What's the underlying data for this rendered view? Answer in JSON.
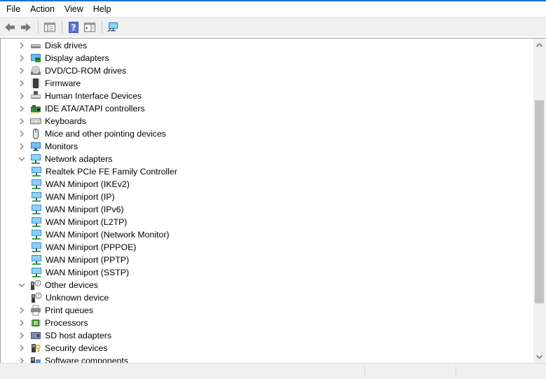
{
  "menu": [
    {
      "key": "file",
      "label": "File"
    },
    {
      "key": "action",
      "label": "Action"
    },
    {
      "key": "view",
      "label": "View"
    },
    {
      "key": "help",
      "label": "Help"
    }
  ],
  "toolbar": [
    {
      "name": "back-button",
      "icon": "arrow-left-icon"
    },
    {
      "name": "forward-button",
      "icon": "arrow-right-icon"
    },
    {
      "sep": true
    },
    {
      "name": "show-hide-console-tree-button",
      "icon": "console-tree-icon"
    },
    {
      "sep": true
    },
    {
      "name": "help-button",
      "icon": "help-icon"
    },
    {
      "name": "show-action-pane-button",
      "icon": "action-pane-icon"
    },
    {
      "sep": true
    },
    {
      "name": "scan-hardware-changes-button",
      "icon": "monitor-scan-icon"
    }
  ],
  "tree": [
    {
      "label": "Disk drives",
      "level": 0,
      "state": "collapsed",
      "icon": "disk-drive"
    },
    {
      "label": "Display adapters",
      "level": 0,
      "state": "collapsed",
      "icon": "display-adapter"
    },
    {
      "label": "DVD/CD-ROM drives",
      "level": 0,
      "state": "collapsed",
      "icon": "dvd"
    },
    {
      "label": "Firmware",
      "level": 0,
      "state": "collapsed",
      "icon": "firmware"
    },
    {
      "label": "Human Interface Devices",
      "level": 0,
      "state": "collapsed",
      "icon": "hid"
    },
    {
      "label": "IDE ATA/ATAPI controllers",
      "level": 0,
      "state": "collapsed",
      "icon": "ide-controller"
    },
    {
      "label": "Keyboards",
      "level": 0,
      "state": "collapsed",
      "icon": "keyboard"
    },
    {
      "label": "Mice and other pointing devices",
      "level": 0,
      "state": "collapsed",
      "icon": "mouse"
    },
    {
      "label": "Monitors",
      "level": 0,
      "state": "collapsed",
      "icon": "monitor"
    },
    {
      "label": "Network adapters",
      "level": 0,
      "state": "expanded",
      "icon": "network"
    },
    {
      "label": "Realtek PCIe FE Family Controller",
      "level": 1,
      "state": "none",
      "icon": "network"
    },
    {
      "label": "WAN Miniport (IKEv2)",
      "level": 1,
      "state": "none",
      "icon": "network"
    },
    {
      "label": "WAN Miniport (IP)",
      "level": 1,
      "state": "none",
      "icon": "network"
    },
    {
      "label": "WAN Miniport (IPv6)",
      "level": 1,
      "state": "none",
      "icon": "network"
    },
    {
      "label": "WAN Miniport (L2TP)",
      "level": 1,
      "state": "none",
      "icon": "network"
    },
    {
      "label": "WAN Miniport (Network Monitor)",
      "level": 1,
      "state": "none",
      "icon": "network"
    },
    {
      "label": "WAN Miniport (PPPOE)",
      "level": 1,
      "state": "none",
      "icon": "network"
    },
    {
      "label": "WAN Miniport (PPTP)",
      "level": 1,
      "state": "none",
      "icon": "network"
    },
    {
      "label": "WAN Miniport (SSTP)",
      "level": 1,
      "state": "none",
      "icon": "network"
    },
    {
      "label": "Other devices",
      "level": 0,
      "state": "expanded",
      "icon": "unknown-device"
    },
    {
      "label": "Unknown device",
      "level": 1,
      "state": "none",
      "icon": "unknown-device"
    },
    {
      "label": "Print queues",
      "level": 0,
      "state": "collapsed",
      "icon": "printer"
    },
    {
      "label": "Processors",
      "level": 0,
      "state": "collapsed",
      "icon": "processor"
    },
    {
      "label": "SD host adapters",
      "level": 0,
      "state": "collapsed",
      "icon": "sd-adapter"
    },
    {
      "label": "Security devices",
      "level": 0,
      "state": "collapsed",
      "icon": "security-device"
    },
    {
      "label": "Software components",
      "level": 0,
      "state": "collapsed",
      "icon": "software-component"
    }
  ],
  "colors": {
    "accent": "#1e6fd9",
    "network_icon": "#3a8fd6",
    "scroll_thumb": "#c2c2c2"
  }
}
